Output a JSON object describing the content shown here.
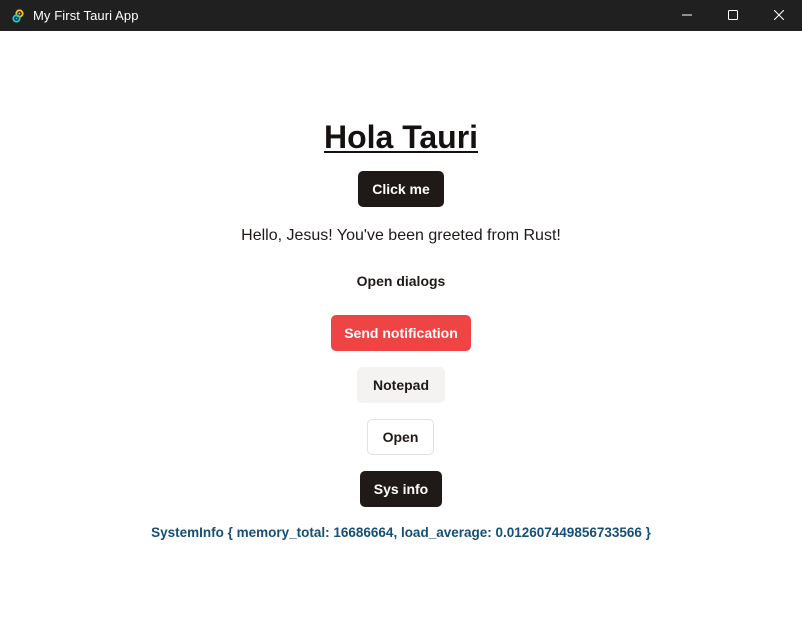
{
  "window": {
    "title": "My First Tauri App",
    "app_icon": "tauri-logo-icon",
    "controls": [
      "minimize-icon",
      "maximize-icon",
      "close-icon"
    ]
  },
  "main": {
    "heading": "Hola Tauri",
    "click_button_label": "Click me",
    "greeting": "Hello, Jesus! You've been greeted from Rust!",
    "dialogs_label": "Open dialogs",
    "notification_button_label": "Send notification",
    "notepad_button_label": "Notepad",
    "open_button_label": "Open",
    "sysinfo_button_label": "Sys info",
    "sysinfo_output": "SystemInfo { memory_total: 16686664, load_average: 0.012607449856733566 }"
  },
  "colors": {
    "titlebar_bg": "#202020",
    "dark_button": "#1f1917",
    "notification_button": "#ef4444",
    "light_button": "#f4f3f2",
    "sysinfo_text": "#164e76"
  }
}
